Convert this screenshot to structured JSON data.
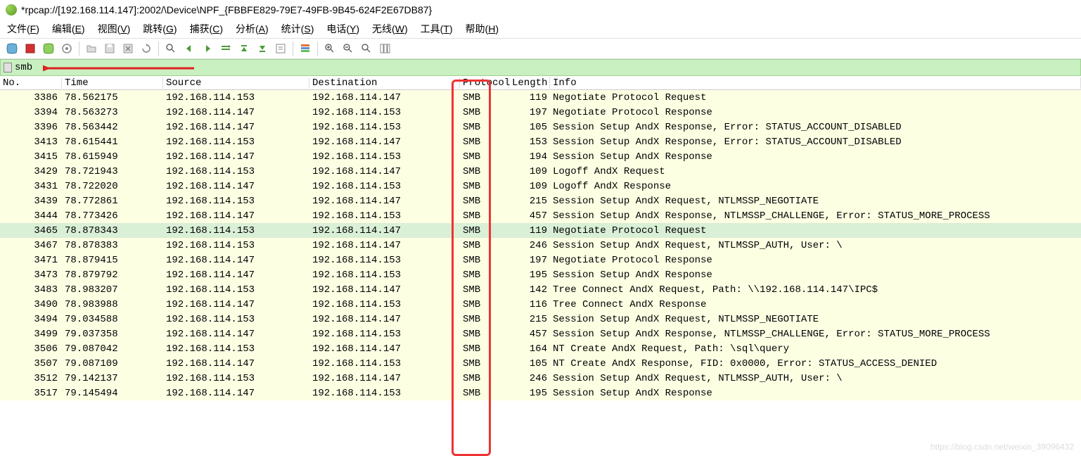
{
  "window": {
    "title": "*rpcap://[192.168.114.147]:2002/\\Device\\NPF_{FBBFE829-79E7-49FB-9B45-624F2E67DB87}"
  },
  "menu": {
    "file": "文件(F)",
    "edit": "编辑(E)",
    "view": "视图(V)",
    "go": "跳转(G)",
    "capture": "捕获(C)",
    "analyze": "分析(A)",
    "stats": "统计(S)",
    "telephony": "电话(Y)",
    "wireless": "无线(W)",
    "tools": "工具(T)",
    "help": "帮助(H)"
  },
  "filter": {
    "value": "smb"
  },
  "columns": {
    "no": "No.",
    "time": "Time",
    "src": "Source",
    "dst": "Destination",
    "proto": "Protocol",
    "len": "Length",
    "info": "Info"
  },
  "packets": [
    {
      "no": "3386",
      "time": "78.562175",
      "src": "192.168.114.153",
      "dst": "192.168.114.147",
      "proto": "SMB",
      "len": "119",
      "info": "Negotiate Protocol Request"
    },
    {
      "no": "3394",
      "time": "78.563273",
      "src": "192.168.114.147",
      "dst": "192.168.114.153",
      "proto": "SMB",
      "len": "197",
      "info": "Negotiate Protocol Response"
    },
    {
      "no": "3396",
      "time": "78.563442",
      "src": "192.168.114.147",
      "dst": "192.168.114.153",
      "proto": "SMB",
      "len": "105",
      "info": "Session Setup AndX Response, Error: STATUS_ACCOUNT_DISABLED"
    },
    {
      "no": "3413",
      "time": "78.615441",
      "src": "192.168.114.153",
      "dst": "192.168.114.147",
      "proto": "SMB",
      "len": "153",
      "info": "Session Setup AndX Response, Error: STATUS_ACCOUNT_DISABLED"
    },
    {
      "no": "3415",
      "time": "78.615949",
      "src": "192.168.114.147",
      "dst": "192.168.114.153",
      "proto": "SMB",
      "len": "194",
      "info": "Session Setup AndX Response"
    },
    {
      "no": "3429",
      "time": "78.721943",
      "src": "192.168.114.153",
      "dst": "192.168.114.147",
      "proto": "SMB",
      "len": "109",
      "info": "Logoff AndX Request"
    },
    {
      "no": "3431",
      "time": "78.722020",
      "src": "192.168.114.147",
      "dst": "192.168.114.153",
      "proto": "SMB",
      "len": "109",
      "info": "Logoff AndX Response"
    },
    {
      "no": "3439",
      "time": "78.772861",
      "src": "192.168.114.153",
      "dst": "192.168.114.147",
      "proto": "SMB",
      "len": "215",
      "info": "Session Setup AndX Request, NTLMSSP_NEGOTIATE"
    },
    {
      "no": "3444",
      "time": "78.773426",
      "src": "192.168.114.147",
      "dst": "192.168.114.153",
      "proto": "SMB",
      "len": "457",
      "info": "Session Setup AndX Response, NTLMSSP_CHALLENGE, Error: STATUS_MORE_PROCESS"
    },
    {
      "no": "3465",
      "time": "78.878343",
      "src": "192.168.114.153",
      "dst": "192.168.114.147",
      "proto": "SMB",
      "len": "119",
      "info": "Negotiate Protocol Request",
      "selected": true
    },
    {
      "no": "3467",
      "time": "78.878383",
      "src": "192.168.114.153",
      "dst": "192.168.114.147",
      "proto": "SMB",
      "len": "246",
      "info": "Session Setup AndX Request, NTLMSSP_AUTH, User: \\"
    },
    {
      "no": "3471",
      "time": "78.879415",
      "src": "192.168.114.147",
      "dst": "192.168.114.153",
      "proto": "SMB",
      "len": "197",
      "info": "Negotiate Protocol Response"
    },
    {
      "no": "3473",
      "time": "78.879792",
      "src": "192.168.114.147",
      "dst": "192.168.114.153",
      "proto": "SMB",
      "len": "195",
      "info": "Session Setup AndX Response"
    },
    {
      "no": "3483",
      "time": "78.983207",
      "src": "192.168.114.153",
      "dst": "192.168.114.147",
      "proto": "SMB",
      "len": "142",
      "info": "Tree Connect AndX Request, Path: \\\\192.168.114.147\\IPC$"
    },
    {
      "no": "3490",
      "time": "78.983988",
      "src": "192.168.114.147",
      "dst": "192.168.114.153",
      "proto": "SMB",
      "len": "116",
      "info": "Tree Connect AndX Response"
    },
    {
      "no": "3494",
      "time": "79.034588",
      "src": "192.168.114.153",
      "dst": "192.168.114.147",
      "proto": "SMB",
      "len": "215",
      "info": "Session Setup AndX Request, NTLMSSP_NEGOTIATE"
    },
    {
      "no": "3499",
      "time": "79.037358",
      "src": "192.168.114.147",
      "dst": "192.168.114.153",
      "proto": "SMB",
      "len": "457",
      "info": "Session Setup AndX Response, NTLMSSP_CHALLENGE, Error: STATUS_MORE_PROCESS"
    },
    {
      "no": "3506",
      "time": "79.087042",
      "src": "192.168.114.153",
      "dst": "192.168.114.147",
      "proto": "SMB",
      "len": "164",
      "info": "NT Create AndX Request, Path: \\sql\\query"
    },
    {
      "no": "3507",
      "time": "79.087109",
      "src": "192.168.114.147",
      "dst": "192.168.114.153",
      "proto": "SMB",
      "len": "105",
      "info": "NT Create AndX Response, FID: 0x0000, Error: STATUS_ACCESS_DENIED"
    },
    {
      "no": "3512",
      "time": "79.142137",
      "src": "192.168.114.153",
      "dst": "192.168.114.147",
      "proto": "SMB",
      "len": "246",
      "info": "Session Setup AndX Request, NTLMSSP_AUTH, User: \\"
    },
    {
      "no": "3517",
      "time": "79.145494",
      "src": "192.168.114.147",
      "dst": "192.168.114.153",
      "proto": "SMB",
      "len": "195",
      "info": "Session Setup AndX Response"
    }
  ],
  "watermark": "https://blog.csdn.net/weixin_39096432",
  "colors": {
    "accent": "#5a9b2a",
    "filterbg": "#c8f0c0",
    "rowbg": "#fdffe3",
    "selected": "#d9efd6",
    "highlight": "#ee3333"
  }
}
